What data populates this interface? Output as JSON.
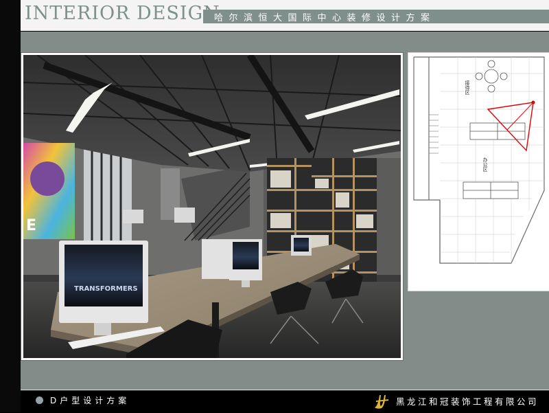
{
  "header": {
    "title": "INTERIOR DESIGN",
    "subtitle": "哈尔滨恒大国际中心装修设计方案"
  },
  "rendering": {
    "poster_text": "E",
    "monitor_text": "TRANSFORMERS"
  },
  "floor_plan": {
    "room_label_1": "接待区",
    "room_label_2": "办公区"
  },
  "footer": {
    "label": "D户型设计方案",
    "company": "黑龙江和冠装饰工程有限公司"
  },
  "colors": {
    "accent_gray": "#7f8f8c",
    "gold_logo": "#e0b43a",
    "view_cone": "#e00000"
  }
}
